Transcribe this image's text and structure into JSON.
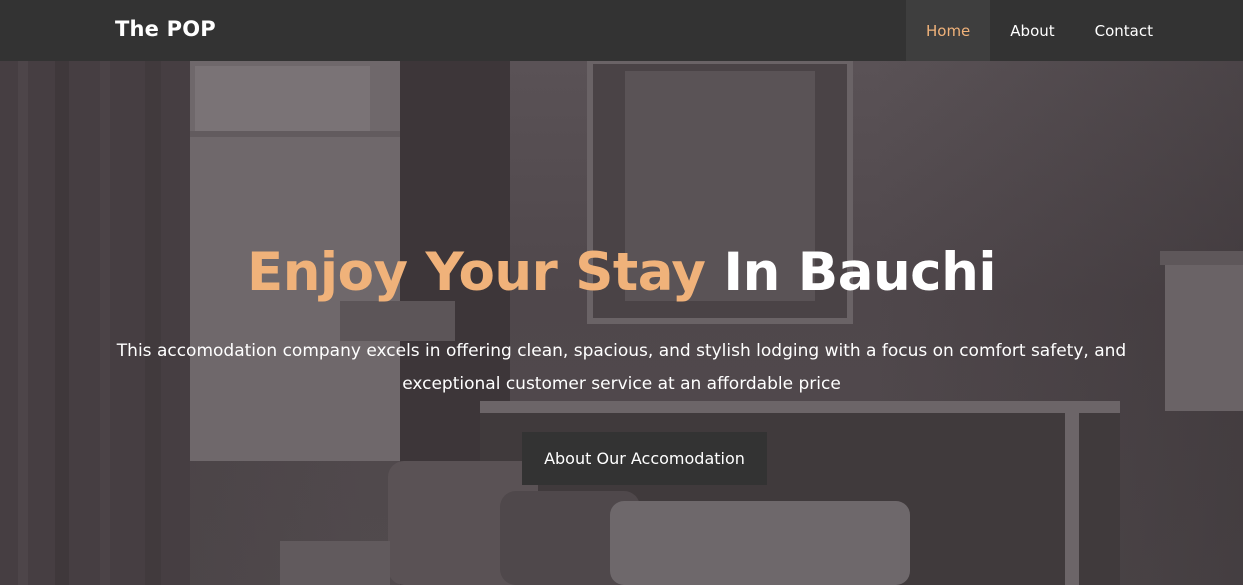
{
  "navbar": {
    "brand": "The POP",
    "items": [
      {
        "label": "Home",
        "active": true
      },
      {
        "label": "About",
        "active": false
      },
      {
        "label": "Contact",
        "active": false
      }
    ]
  },
  "hero": {
    "title_accent": "Enjoy Your Stay",
    "title_rest": "In Bauchi",
    "description_line1": "This accomodation company excels in offering clean, spacious, and stylish lodging with a focus on comfort safety, and",
    "description_line2": "exceptional customer service at an affordable price",
    "cta_label": "About Our Accomodation"
  },
  "colors": {
    "navbar_bg": "#333333",
    "accent": "#f0b27a",
    "text": "#ffffff",
    "button_bg": "#333333",
    "hero_overlay": "#4f474b"
  }
}
